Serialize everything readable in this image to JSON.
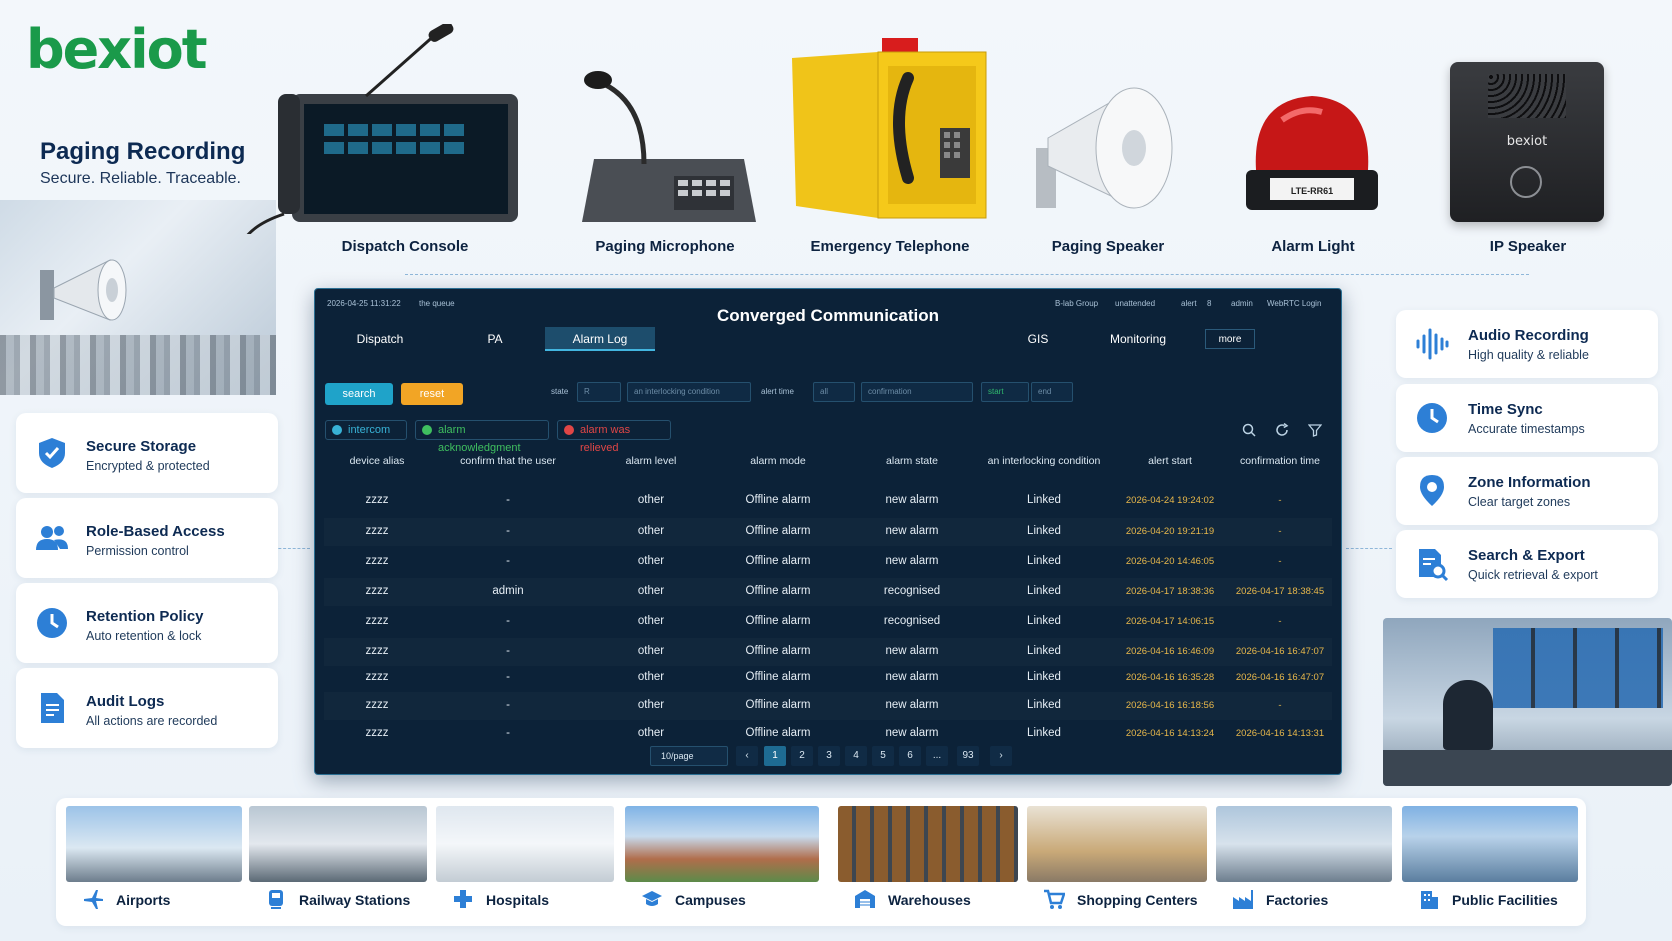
{
  "brand": {
    "logo": "bexiot"
  },
  "hero": {
    "title": "Paging Recording",
    "subtitle": "Secure. Reliable. Traceable."
  },
  "devices": [
    {
      "label": "Dispatch Console",
      "icon": "dispatch-console"
    },
    {
      "label": "Paging Microphone",
      "icon": "paging-microphone"
    },
    {
      "label": "Emergency Telephone",
      "icon": "emergency-telephone"
    },
    {
      "label": "Paging Speaker",
      "icon": "horn-speaker"
    },
    {
      "label": "Alarm Light",
      "icon": "alarm-light"
    },
    {
      "label": "IP Speaker",
      "icon": "ip-speaker"
    }
  ],
  "alarm_light_tag": "LTE-RR61",
  "ip_speaker_brand": "bexiot",
  "left_features": [
    {
      "title": "Secure Storage",
      "subtitle": "Encrypted & protected",
      "icon": "shield-icon"
    },
    {
      "title": "Role-Based Access",
      "subtitle": "Permission control",
      "icon": "users-icon"
    },
    {
      "title": "Retention Policy",
      "subtitle": "Auto retention & lock",
      "icon": "clock-icon"
    },
    {
      "title": "Audit Logs",
      "subtitle": "All actions are recorded",
      "icon": "document-icon"
    }
  ],
  "right_features": [
    {
      "title": "Audio Recording",
      "subtitle": "High quality & reliable",
      "icon": "waveform-icon"
    },
    {
      "title": "Time Sync",
      "subtitle": "Accurate timestamps",
      "icon": "clock-icon"
    },
    {
      "title": "Zone Information",
      "subtitle": "Clear target zones",
      "icon": "location-pin-icon"
    },
    {
      "title": "Search & Export",
      "subtitle": "Quick retrieval & export",
      "icon": "search-document-icon"
    }
  ],
  "dashboard": {
    "title": "Converged Communication",
    "datetime": "2026-04-25 11:31:22",
    "top_left_status": "the queue",
    "top_right": {
      "group": "B-lab Group",
      "unattended": "unattended",
      "alert": "alert",
      "alert_count": "8",
      "user": "admin",
      "webrtc": "WebRTC Login"
    },
    "tabs": [
      "Dispatch",
      "PA",
      "Alarm Log",
      "GIS",
      "Monitoring",
      "more"
    ],
    "active_tab": "Alarm Log",
    "filters": {
      "search_label": "search",
      "reset_label": "reset",
      "state_label": "state",
      "state_value": "R",
      "interlocking_placeholder": "an interlocking condition",
      "alert_time_label": "alert time",
      "alert_time_value": "all",
      "third_select": "confirmation",
      "start_label": "start",
      "end_label": "end"
    },
    "chips": [
      {
        "label": "intercom",
        "color": "#38b2d6"
      },
      {
        "label": "alarm acknowledgment",
        "color": "#3fbf5f"
      },
      {
        "label": "alarm was relieved",
        "color": "#e04646"
      }
    ],
    "columns": [
      "device alias",
      "confirm that the user",
      "alarm level",
      "alarm mode",
      "alarm state",
      "an interlocking condition",
      "alert start",
      "confirmation time"
    ],
    "rows": [
      [
        "zzzz",
        "-",
        "other",
        "Offline alarm",
        "new alarm",
        "Linked",
        "2026-04-24 19:24:02",
        "-"
      ],
      [
        "zzzz",
        "-",
        "other",
        "Offline alarm",
        "new alarm",
        "Linked",
        "2026-04-20 19:21:19",
        "-"
      ],
      [
        "zzzz",
        "-",
        "other",
        "Offline alarm",
        "new alarm",
        "Linked",
        "2026-04-20 14:46:05",
        "-"
      ],
      [
        "zzzz",
        "admin",
        "other",
        "Offline alarm",
        "recognised",
        "Linked",
        "2026-04-17 18:38:36",
        "2026-04-17 18:38:45"
      ],
      [
        "zzzz",
        "-",
        "other",
        "Offline alarm",
        "recognised",
        "Linked",
        "2026-04-17 14:06:15",
        "-"
      ],
      [
        "zzzz",
        "-",
        "other",
        "Offline alarm",
        "new alarm",
        "Linked",
        "2026-04-16 16:46:09",
        "2026-04-16 16:47:07"
      ],
      [
        "zzzz",
        "-",
        "other",
        "Offline alarm",
        "new alarm",
        "Linked",
        "2026-04-16 16:35:28",
        "2026-04-16 16:47:07"
      ],
      [
        "zzzz",
        "-",
        "other",
        "Offline alarm",
        "new alarm",
        "Linked",
        "2026-04-16 16:18:56",
        "-"
      ],
      [
        "zzzz",
        "-",
        "other",
        "Offline alarm",
        "new alarm",
        "Linked",
        "2026-04-16 14:13:24",
        "2026-04-16 14:13:31"
      ]
    ],
    "pagination": {
      "per_page": "10/page",
      "pages": [
        "1",
        "2",
        "3",
        "4",
        "5",
        "6",
        "...",
        "93"
      ],
      "active": "1"
    }
  },
  "scenarios": [
    {
      "label": "Airports",
      "icon": "airplane-icon"
    },
    {
      "label": "Railway Stations",
      "icon": "train-icon"
    },
    {
      "label": "Hospitals",
      "icon": "medical-cross-icon"
    },
    {
      "label": "Campuses",
      "icon": "graduation-cap-icon"
    },
    {
      "label": "Warehouses",
      "icon": "warehouse-icon"
    },
    {
      "label": "Shopping Centers",
      "icon": "cart-icon"
    },
    {
      "label": "Factories",
      "icon": "factory-icon"
    },
    {
      "label": "Public Facilities",
      "icon": "building-icon"
    }
  ],
  "colors": {
    "brand_green": "#1a9a4a",
    "accent_blue": "#2d7fd6",
    "dash_bg": "#0c2238",
    "search_btn": "#1fa3c9",
    "reset_btn": "#f2a525",
    "time_text": "#e8b84b"
  }
}
